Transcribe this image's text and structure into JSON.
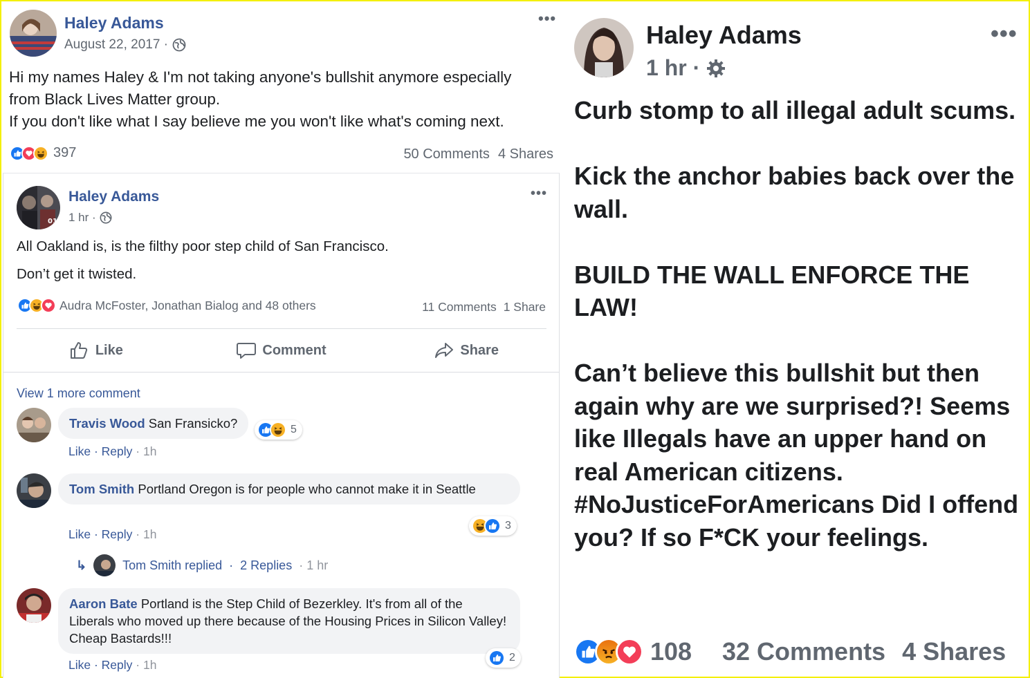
{
  "post1": {
    "author": "Haley Adams",
    "date": "August 22, 2017 ·",
    "menu": "•••",
    "text_lines": [
      "Hi my names Haley & I'm not taking anyone's bullshit anymore especially",
      "from Black Lives Matter group.",
      "If you don't like what I say believe me you won't like what's coming next."
    ],
    "reactions": [
      "like",
      "love",
      "haha"
    ],
    "reaction_count": "397",
    "comments": "50 Comments",
    "shares": "4 Shares"
  },
  "post2": {
    "author": "Haley Adams",
    "time": "1 hr ·",
    "menu": "•••",
    "line1": "All Oakland is, is the filthy poor step child of San Francisco.",
    "line2": "Don’t get it twisted.",
    "reactions": [
      "like",
      "haha",
      "love"
    ],
    "reaction_names": "Audra McFoster, Jonathan Bialog and 48 others",
    "comments": "11 Comments",
    "shares": "1 Share",
    "actions": {
      "like": "Like",
      "comment": "Comment",
      "share": "Share"
    },
    "view_more": "View 1 more comment",
    "comment_list": [
      {
        "name": "Travis Wood",
        "text": "San Fransicko?",
        "reactions": [
          "like",
          "haha"
        ],
        "count": "5",
        "like": "Like",
        "reply": "Reply",
        "time": "1h"
      },
      {
        "name": "Tom Smith",
        "text": "Portland Oregon is for people who cannot make it in Seattle",
        "reactions": [
          "haha",
          "like"
        ],
        "count": "3",
        "like": "Like",
        "reply": "Reply",
        "time": "1h"
      },
      {
        "name": "Aaron Bate",
        "text": "Portland is the Step Child of Bezerkley. It's from all of the Liberals who moved up there because of the Housing Prices in Silicon Valley! Cheap Bastards!!!",
        "reactions": [
          "like"
        ],
        "count": "2",
        "like": "Like",
        "reply": "Reply",
        "time": "1h"
      }
    ],
    "replied": {
      "name": "Tom Smith replied",
      "replies": "2 Replies",
      "time": "1 hr"
    }
  },
  "post3": {
    "author": "Haley Adams",
    "time": "1 hr ·",
    "menu": "•••",
    "paragraphs": [
      "Curb stomp to all illegal adult scums.",
      "Kick the anchor babies back over the wall.",
      "BUILD THE WALL ENFORCE THE LAW!",
      "Can’t believe this bullshit but then again why are we surprised?! Seems like Illegals have an upper hand on real American citizens. #NoJusticeForAmericans Did I offend you? If so F*CK your feelings."
    ],
    "reactions": [
      "like",
      "angry",
      "love"
    ],
    "reaction_count": "108",
    "comments": "32 Comments",
    "shares": "4 Shares"
  },
  "colors": {
    "link": "#385898",
    "meta": "#606770",
    "like_blue": "#1877f2",
    "love_red": "#f33e58",
    "haha_yellow": "#f7b125",
    "angry_orange": "#e9710f",
    "frame": "#f4f000"
  }
}
